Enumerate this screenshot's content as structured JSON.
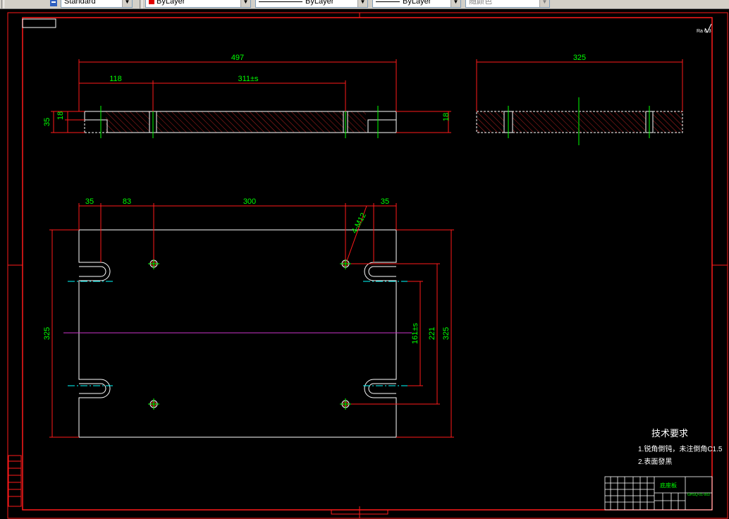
{
  "toolbar": {
    "text_style": "Standard",
    "color": "ByLayer",
    "linetype": "ByLayer",
    "lineweight": "ByLayer",
    "plot_style": "随颜色",
    "accent_color": "#e00000"
  },
  "drawing": {
    "top_view": {
      "overall_length": "497",
      "left_segment": "118",
      "hole_span": "311±s",
      "height_total": "35",
      "height_step": "18",
      "right_thickness": "18"
    },
    "side_view": {
      "width": "325"
    },
    "plan_view": {
      "edge_left": "35",
      "hole_offset": "83",
      "hole_pitch": "300",
      "edge_right": "35",
      "thread_callout": "4-M12",
      "height_left": "325",
      "slot_pitch": "161±s",
      "hole_pitch_v": "221",
      "height_right": "325"
    },
    "surface_symbol": "Ra 6.3",
    "tech_requirements": {
      "title": "技术要求",
      "line1": "1.锐角倒钝，未注倒角C1.5",
      "line2": "2.表面發黑"
    },
    "title_block": {
      "part_name": "底座板",
      "drawing_no": "GHSQ-01-002"
    }
  },
  "colors": {
    "dimension": "#ff1a1a",
    "text": "#00ff00",
    "outline": "#ffffff",
    "hatch": "#b22222",
    "centerline": "#00ffff",
    "construction": "#cc33cc",
    "background": "#000000"
  }
}
